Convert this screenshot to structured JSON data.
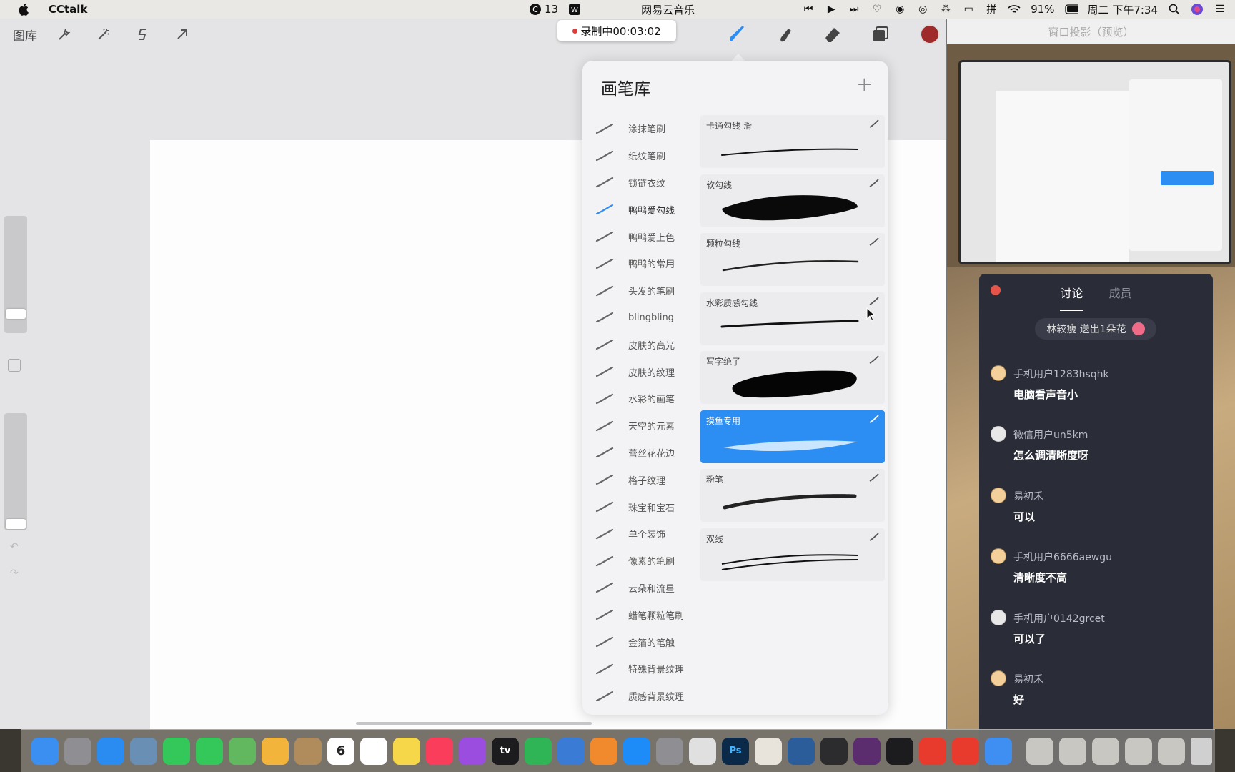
{
  "menubar": {
    "app_name": "CCtalk",
    "cc_count": "13",
    "music_app": "网易云音乐",
    "battery": "91%",
    "datetime": "周二 下午7:34"
  },
  "procreate": {
    "gallery_label": "图库",
    "recording": "录制中00:03:02",
    "current_color": "#9e2a2b",
    "brush_library": {
      "title": "画笔库",
      "add": "+",
      "sets": [
        "涂抹笔刷",
        "纸纹笔刷",
        "锁链衣纹",
        "鸭鸭爱勾线",
        "鸭鸭爱上色",
        "鸭鸭的常用",
        "头发的笔刷",
        "blingbling",
        "皮肤的高光",
        "皮肤的纹理",
        "水彩的画笔",
        "天空的元素",
        "蕾丝花花边",
        "格子纹理",
        "珠宝和宝石",
        "单个装饰",
        "像素的笔刷",
        "云朵和流星",
        "蜡笔颗粒笔刷",
        "金箔的笔触",
        "特殊背景纹理",
        "质感背景纹理"
      ],
      "active_set_index": 3,
      "brushes": [
        {
          "name": "卡通勾线 滑"
        },
        {
          "name": "软勾线"
        },
        {
          "name": "颗粒勾线"
        },
        {
          "name": "水彩质感勾线"
        },
        {
          "name": "写字绝了"
        },
        {
          "name": "摸鱼专用"
        },
        {
          "name": "粉笔"
        },
        {
          "name": "双线"
        }
      ],
      "selected_brush_index": 5
    }
  },
  "preview": {
    "title": "窗口投影（预览）"
  },
  "chat": {
    "tabs": [
      "讨论",
      "成员"
    ],
    "gift_text": "林较瘦 送出1朵花",
    "messages": [
      {
        "user": "手机用户1283hsqhk",
        "text": "电脑看声音小",
        "avatar": "cartoon"
      },
      {
        "user": "微信用户un5km",
        "text": "怎么调清晰度呀",
        "avatar": "blank"
      },
      {
        "user": "易初禾",
        "text": "可以",
        "avatar": "cartoon"
      },
      {
        "user": "手机用户6666aewgu",
        "text": "清晰度不高",
        "avatar": "cartoon"
      },
      {
        "user": "手机用户0142grcet",
        "text": "可以了",
        "avatar": "blank"
      },
      {
        "user": "易初禾",
        "text": "好",
        "avatar": "cartoon"
      }
    ]
  },
  "dock": {
    "calendar_day": "6",
    "apps": [
      {
        "name": "finder-icon",
        "color": "#3b8ff0"
      },
      {
        "name": "launchpad-icon",
        "color": "#8e8e93"
      },
      {
        "name": "safari-icon",
        "color": "#2a8cf0"
      },
      {
        "name": "preview-icon",
        "color": "#6a8fb5"
      },
      {
        "name": "facetime-icon",
        "color": "#34c759"
      },
      {
        "name": "messages-icon",
        "color": "#34c759"
      },
      {
        "name": "maps-icon",
        "color": "#62b85f"
      },
      {
        "name": "photos-icon",
        "color": "#f3b43c"
      },
      {
        "name": "contacts-icon",
        "color": "#b08b5b"
      },
      {
        "name": "calendar-icon",
        "color": "#ffffff"
      },
      {
        "name": "reminders-icon",
        "color": "#ffffff"
      },
      {
        "name": "notes-icon",
        "color": "#f7d74a"
      },
      {
        "name": "music-icon",
        "color": "#fa3d5a"
      },
      {
        "name": "podcasts-icon",
        "color": "#9b4de0"
      },
      {
        "name": "tv-icon",
        "color": "#1c1c1e"
      },
      {
        "name": "numbers-icon",
        "color": "#2fb556"
      },
      {
        "name": "keynote-icon",
        "color": "#3a7bd5"
      },
      {
        "name": "pages-icon",
        "color": "#f08a2c"
      },
      {
        "name": "appstore-icon",
        "color": "#1d8cf8"
      },
      {
        "name": "system-preferences-icon",
        "color": "#8e8e93"
      },
      {
        "name": "davinci-icon",
        "color": "#e0e0e0"
      },
      {
        "name": "photoshop-icon",
        "color": "#0b2a4a"
      },
      {
        "name": "wps-w-icon",
        "color": "#e8e4dc"
      },
      {
        "name": "quicktime-icon",
        "color": "#2b5d9b"
      },
      {
        "name": "obs-icon",
        "color": "#2c2c2e"
      },
      {
        "name": "ar-app-icon",
        "color": "#5b2d6e"
      },
      {
        "name": "terminal-icon",
        "color": "#1c1c1e"
      },
      {
        "name": "wps-icon",
        "color": "#e83b2e"
      },
      {
        "name": "netease-music-icon",
        "color": "#e83b2e"
      },
      {
        "name": "cctalk-icon",
        "color": "#3f8ff2"
      },
      {
        "name": "screenshot-folder-icon",
        "color": "#c9c7c2"
      },
      {
        "name": "screenshot-folder-icon-2",
        "color": "#c9c7c2"
      },
      {
        "name": "screenshot-folder-icon-3",
        "color": "#c9c7c2"
      },
      {
        "name": "screenshot-folder-icon-4",
        "color": "#c9c7c2"
      },
      {
        "name": "screenshot-folder-icon-5",
        "color": "#c9c7c2"
      },
      {
        "name": "trash-icon",
        "color": "#d0d0d0"
      }
    ],
    "labels": {
      "photoshop": "Ps",
      "tv": "tv"
    }
  }
}
